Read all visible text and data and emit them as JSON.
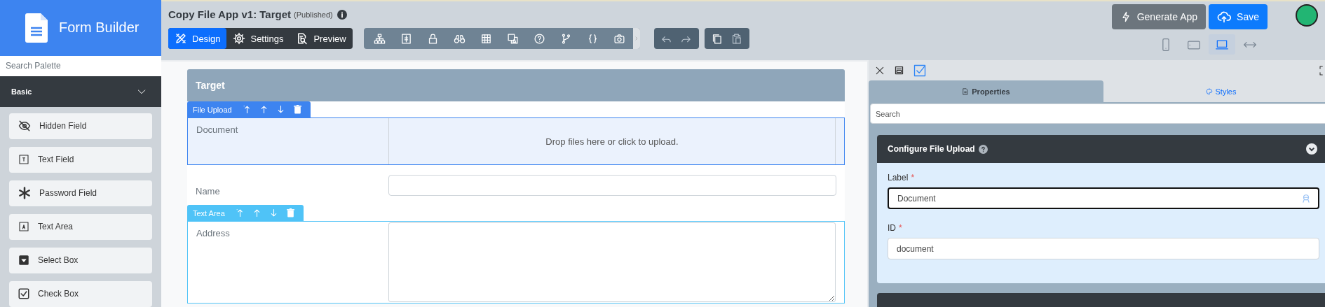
{
  "app": {
    "title": "Form Builder"
  },
  "palette": {
    "search_placeholder": "Search Palette",
    "group": {
      "label": "Basic",
      "expanded": true
    },
    "items": [
      {
        "label": "Hidden Field",
        "kind": "hidden"
      },
      {
        "label": "Text Field",
        "kind": "text"
      },
      {
        "label": "Password Field",
        "kind": "password"
      },
      {
        "label": "Text Area",
        "kind": "textarea"
      },
      {
        "label": "Select Box",
        "kind": "select"
      },
      {
        "label": "Check Box",
        "kind": "checkbox"
      }
    ]
  },
  "header": {
    "title": "Copy File App v1: Target",
    "status": "(Published)"
  },
  "mode_tabs": [
    {
      "label": "Design",
      "kind": "design",
      "selected": true
    },
    {
      "label": "Settings",
      "kind": "settings",
      "selected": false
    },
    {
      "label": "Preview",
      "kind": "preview",
      "selected": false
    }
  ],
  "actions": [
    {
      "label": "Generate App",
      "kind": "generate"
    },
    {
      "label": "Save",
      "kind": "save"
    }
  ],
  "devices": [
    {
      "kind": "phone",
      "selected": false
    },
    {
      "kind": "tablet",
      "selected": false
    },
    {
      "kind": "laptop",
      "selected": true
    },
    {
      "kind": "full",
      "selected": false
    }
  ],
  "form": {
    "title": "Target",
    "components": [
      {
        "kind": "file",
        "toolbar_label": "File Upload",
        "selected": true,
        "label": "Document",
        "hint": "Drop files here or click to upload."
      },
      {
        "kind": "textfield",
        "label": "Name"
      },
      {
        "kind": "textarea",
        "toolbar_label": "Text Area",
        "selected": false,
        "label": "Address"
      }
    ]
  },
  "inspector": {
    "tabs": [
      {
        "label": "Properties",
        "kind": "properties",
        "selected": true
      },
      {
        "label": "Styles",
        "kind": "styles",
        "selected": false
      }
    ],
    "search_placeholder": "Search",
    "card": {
      "title": "Configure File Upload",
      "fields": [
        {
          "label": "Label",
          "mark": "*",
          "value": "Document",
          "focused": true
        },
        {
          "label": "ID",
          "mark": "*",
          "value": "document",
          "focused": false
        }
      ]
    }
  }
}
